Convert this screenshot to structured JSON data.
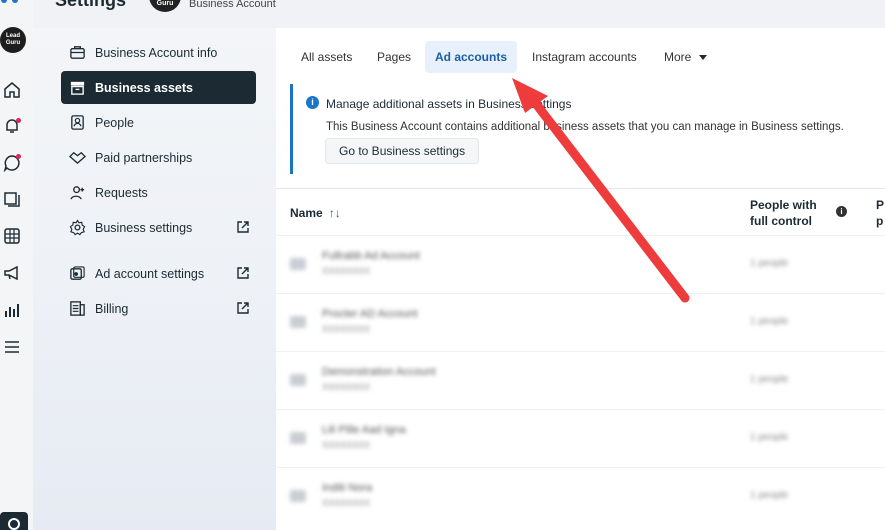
{
  "header": {
    "title": "Settings",
    "avatar_text": "Guru",
    "subtitle": "Business Account"
  },
  "rail": {
    "logo_line1": "Lead",
    "logo_line2": "Guru"
  },
  "sidebar": {
    "items": [
      {
        "label": "Business Account info",
        "icon": "briefcase-icon"
      },
      {
        "label": "Business assets",
        "icon": "box-icon",
        "active": true
      },
      {
        "label": "People",
        "icon": "person-badge-icon"
      },
      {
        "label": "Paid partnerships",
        "icon": "handshake-icon"
      },
      {
        "label": "Requests",
        "icon": "person-add-icon"
      },
      {
        "label": "Business settings",
        "icon": "gear-icon",
        "external": true
      },
      {
        "label": "Ad account settings",
        "icon": "ad-account-icon",
        "external": true
      },
      {
        "label": "Billing",
        "icon": "billing-icon",
        "external": true
      }
    ]
  },
  "tabs": [
    {
      "label": "All assets"
    },
    {
      "label": "Pages"
    },
    {
      "label": "Ad accounts",
      "active": true
    },
    {
      "label": "Instagram accounts"
    },
    {
      "label": "More"
    }
  ],
  "banner": {
    "title": "Manage additional assets in Business settings",
    "text": "This Business Account contains additional business assets that you can manage in Business settings.",
    "button": "Go to Business settings"
  },
  "table": {
    "col_name": "Name",
    "col_people_line1": "People with",
    "col_people_line2": "full control",
    "col_cut_line1": "P",
    "col_cut_line2": "p",
    "rows": [
      {
        "name": "Fullrabb Ad Account",
        "id": "XXXXXXXX",
        "value": "1 people"
      },
      {
        "name": "Procter AD Account",
        "id": "XXXXXXXX",
        "value": "1 people"
      },
      {
        "name": "Demonstration Account",
        "id": "XXXXXXXX",
        "value": "1 people"
      },
      {
        "name": "Lili Pille Aad Igna",
        "id": "XXXXXXXX",
        "value": "1 people"
      },
      {
        "name": "Inditi Nora",
        "id": "XXXXXXXX",
        "value": "1 people"
      }
    ]
  },
  "colors": {
    "accent": "#1b74c8",
    "active_nav": "#1c2b33",
    "arrow": "#ee3b3b"
  }
}
